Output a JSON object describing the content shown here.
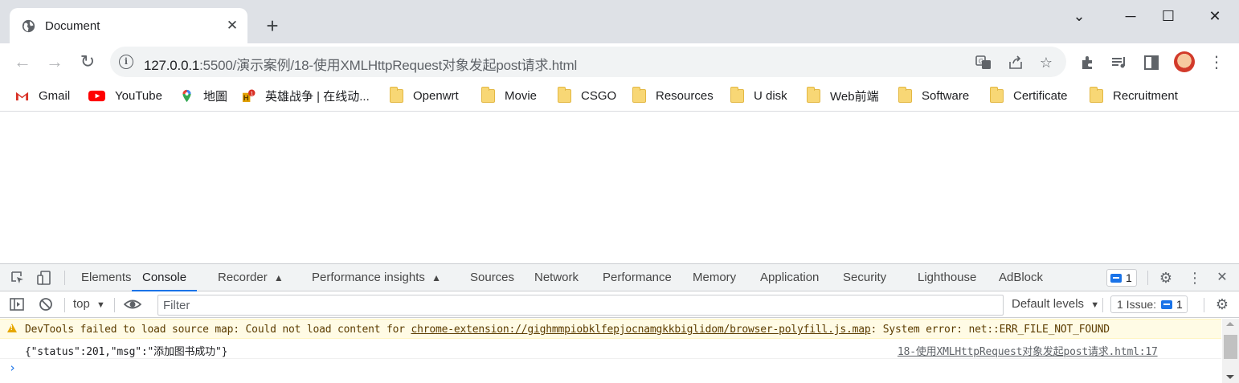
{
  "tab": {
    "title": "Document",
    "close_icon": "close-icon"
  },
  "window": {
    "minimize": "─",
    "maximize": "☐",
    "close": "✕",
    "tabsearch": "⌄"
  },
  "toolbar": {
    "url_host": "127.0.0.1",
    "url_rest": ":5500/演示案例/18-使用XMLHttpRequest对象发起post请求.html"
  },
  "bookmarks": [
    {
      "label": "Gmail",
      "icon": "gmail-icon"
    },
    {
      "label": "YouTube",
      "icon": "youtube-icon"
    },
    {
      "label": "地圖",
      "icon": "maps-icon"
    },
    {
      "label": "英雄战争 | 在线动...",
      "icon": "game-icon"
    },
    {
      "label": "Openwrt",
      "icon": "folder-icon"
    },
    {
      "label": "Movie",
      "icon": "folder-icon"
    },
    {
      "label": "CSGO",
      "icon": "folder-icon"
    },
    {
      "label": "Resources",
      "icon": "folder-icon"
    },
    {
      "label": "U disk",
      "icon": "folder-icon"
    },
    {
      "label": "Web前端",
      "icon": "folder-icon"
    },
    {
      "label": "Software",
      "icon": "folder-icon"
    },
    {
      "label": "Certificate",
      "icon": "folder-icon"
    },
    {
      "label": "Recruitment",
      "icon": "folder-icon"
    }
  ],
  "devtools": {
    "tabs": [
      "Elements",
      "Console",
      "Recorder",
      "Performance insights",
      "Sources",
      "Network",
      "Performance",
      "Memory",
      "Application",
      "Security",
      "Lighthouse",
      "AdBlock"
    ],
    "active_tab": "Console",
    "issues_badge": "1",
    "context": "top",
    "filter_placeholder": "Filter",
    "levels": "Default levels",
    "issue_count": "1 Issue:",
    "issue_number": "1",
    "warning": {
      "prefix": "DevTools failed to load source map: Could not load content for ",
      "link": "chrome-extension://gighmmpiobklfepjocnamgkkbiglidom/browser-polyfill.js.map",
      "suffix": ": System error: net::ERR_FILE_NOT_FOUND"
    },
    "log": {
      "text": "{\"status\":201,\"msg\":\"添加图书成功\"}",
      "source": "18-使用XMLHttpRequest对象发起post请求.html:17"
    },
    "prompt": "›"
  },
  "colors": {
    "accent": "#1a73e8",
    "tabstrip": "#dee1e6",
    "warning_bg": "#fffbe5"
  }
}
